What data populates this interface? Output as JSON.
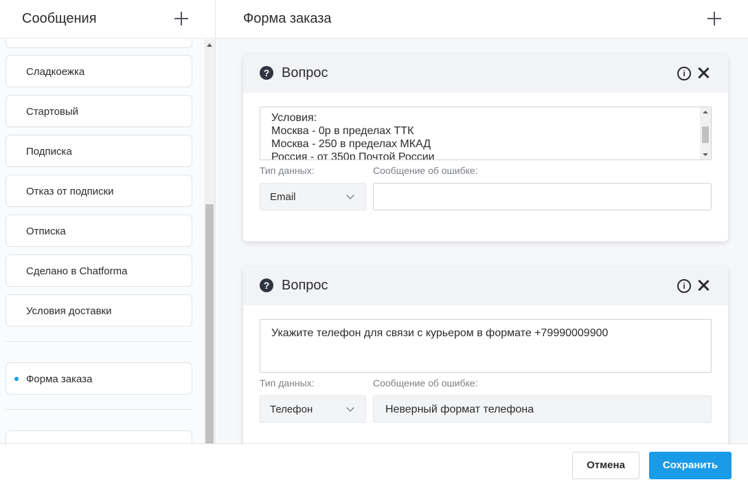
{
  "sidebar": {
    "title": "Сообщения",
    "items": [
      {
        "label": "Сладкоежка"
      },
      {
        "label": "Стартовый"
      },
      {
        "label": "Подписка"
      },
      {
        "label": "Отказ от подписки"
      },
      {
        "label": "Отписка"
      },
      {
        "label": "Сделано в Chatforma"
      },
      {
        "label": "Условия доставки"
      },
      {
        "label": "Форма заказа",
        "active": true
      }
    ]
  },
  "main": {
    "title": "Форма заказа",
    "questions": [
      {
        "title": "Вопрос",
        "text_lines": [
          "Условия:",
          "Москва - 0р в пределах ТТК",
          "Москва - 250 в пределах МКАД",
          "Россия - от 350р Почтой России"
        ],
        "data_type_label": "Тип данных:",
        "data_type_value": "Email",
        "error_label": "Сообщение об ошибке:",
        "error_value": ""
      },
      {
        "title": "Вопрос",
        "text_lines": [
          "Укажите телефон для связи с курьером в формате +79990009900"
        ],
        "data_type_label": "Тип данных:",
        "data_type_value": "Телефон",
        "error_label": "Сообщение об ошибке:",
        "error_value": "Неверный формат телефона"
      }
    ]
  },
  "footer": {
    "cancel_label": "Отмена",
    "save_label": "Сохранить"
  },
  "colors": {
    "accent": "#1a9be8",
    "question_icon": "#2f3440"
  },
  "icons": [
    "plus-icon",
    "question-icon",
    "info-icon",
    "close-icon",
    "chevron-down-icon"
  ]
}
